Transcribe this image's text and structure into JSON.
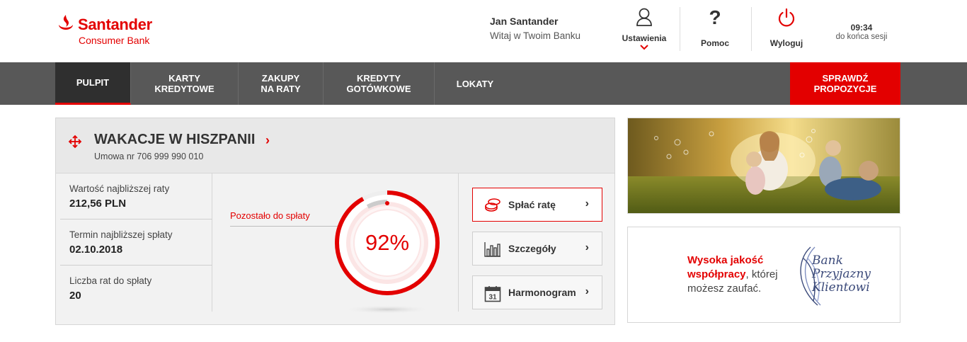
{
  "brand": {
    "name": "Santander",
    "sub": "Consumer Bank",
    "color": "#e30000"
  },
  "user": {
    "name": "Jan Santander",
    "greeting": "Witaj w Twoim Banku"
  },
  "header_buttons": {
    "settings": {
      "label": "Ustawienia",
      "icon": "user-icon"
    },
    "help": {
      "label": "Pomoc",
      "icon": "question-icon"
    },
    "logout": {
      "label": "Wyloguj",
      "icon": "power-icon"
    }
  },
  "session": {
    "time": "09:34",
    "text": "do końca sesji"
  },
  "nav": {
    "items": [
      {
        "label": "PULPIT",
        "active": true
      },
      {
        "label": "KARTY\nKREDYTOWE"
      },
      {
        "label": "ZAKUPY\nNA RATY"
      },
      {
        "label": "KREDYTY\nGOTÓWKOWE"
      },
      {
        "label": "LOKATY"
      }
    ],
    "cta": "SPRAWDŹ\nPROPOZYCJE"
  },
  "loan": {
    "title": "WAKACJE W HISZPANII",
    "contract": "Umowa nr 706 999 990 010",
    "info": [
      {
        "label": "Wartość najbliższej raty",
        "value": "212,56 PLN"
      },
      {
        "label": "Termin najbliższej spłaty",
        "value": "02.10.2018"
      },
      {
        "label": "Liczba rat do spłaty",
        "value": "20"
      }
    ],
    "remaining_label": "Pozostało do spłaty",
    "remaining_percent": 92,
    "remaining_text": "92%",
    "actions": [
      {
        "label": "Spłać ratę",
        "icon": "coins-icon",
        "primary": true
      },
      {
        "label": "Szczegóły",
        "icon": "bar-chart-icon"
      },
      {
        "label": "Harmonogram",
        "icon": "calendar-icon",
        "icon_text": "31"
      }
    ]
  },
  "promo": {
    "red_text": "Wysoka jakość\nwspółpracy",
    "text": ", której\nmożesz zaufać.",
    "logo_text": "Bank\nPrzyjazny\nKlientowi"
  }
}
